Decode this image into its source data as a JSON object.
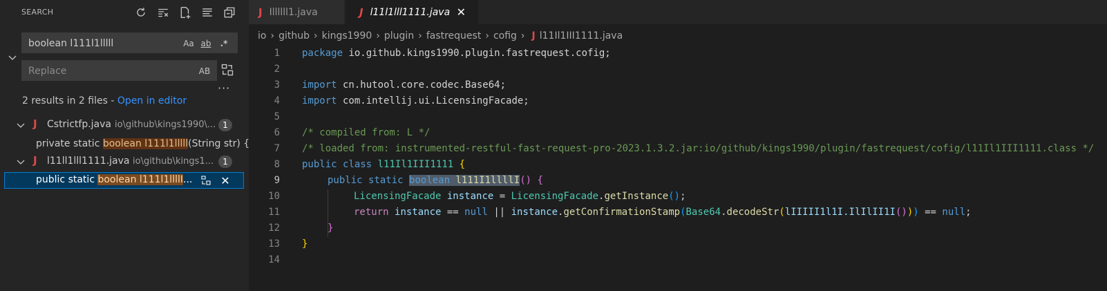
{
  "sidebar": {
    "title": "SEARCH",
    "search_value": "boolean l111l1lllll",
    "opts": {
      "case": "Aa",
      "word": "ab",
      "regex": ".*"
    },
    "replace_placeholder": "Replace",
    "replace_opt": "AB",
    "more": "···",
    "summary_text": "2 results in 2 files - ",
    "summary_link": "Open in editor",
    "files": [
      {
        "name": "Cstrictfp.java",
        "path": "io\\github\\kings1990\\...",
        "count": "1",
        "match_pre": "private static ",
        "match_hl": "boolean l111l1lllll",
        "match_post": "(String str) {"
      },
      {
        "name": "l11ll1lll1111.java",
        "path": "io\\github\\kings1...",
        "count": "1",
        "match_pre": "public static ",
        "match_hl": "boolean l111l1llllI",
        "match_post": "..."
      }
    ]
  },
  "tabs": [
    {
      "label": "Illllll1.java"
    },
    {
      "label": "l11l1lll1111.java",
      "close": "✕"
    }
  ],
  "breadcrumb": [
    "io",
    "github",
    "kings1990",
    "plugin",
    "fastrequest",
    "cofig",
    "l11Il1III1111.java"
  ],
  "editor": {
    "line_numbers": [
      "1",
      "2",
      "3",
      "4",
      "5",
      "6",
      "7",
      "8",
      "9",
      "10",
      "11",
      "12",
      "13",
      "14"
    ],
    "l1": {
      "kw": "package",
      "rest": " io.github.kings1990.plugin.fastrequest.cofig;"
    },
    "l3": {
      "kw": "import",
      "rest": " cn.hutool.core.codec.Base64;"
    },
    "l4": {
      "kw": "import",
      "rest": " com.intellij.ui.LicensingFacade;"
    },
    "l6": "/* compiled from: L */",
    "l7": "/* loaded from: instrumented-restful-fast-request-pro-2023.1.3.2.jar:io/github/kings1990/plugin/fastrequest/cofig/l11Il1III1111.class */",
    "l8": {
      "kw1": "public",
      "kw2": "class",
      "name": "l11Il1III1111",
      "br": "{"
    },
    "l9": {
      "kw1": "public",
      "kw2": "static",
      "type": "boolean",
      "name": "l111I1llllI",
      "parens": "()",
      "br": "{"
    },
    "l10": {
      "type": "LicensingFacade",
      "var": "instance",
      "eq": " = ",
      "cls": "LicensingFacade",
      "fn": "getInstance",
      "parens": "()",
      "semi": ";"
    },
    "l11": {
      "kw": "return",
      "v1": "instance",
      "op1": " == ",
      "null1": "null",
      "op2": " || ",
      "v2": "instance",
      "fn1": "getConfirmationStamp",
      "p1": "(",
      "cls": "Base64",
      "fn2": "decodeStr",
      "p2": "(",
      "arg": "lIIIII1l1I.IlIlII1I",
      "p3": "()",
      "p2c": ")",
      "p1c": ")",
      "op3": " == ",
      "null2": "null",
      "semi": ";"
    },
    "l12": "}",
    "l13": "}"
  }
}
